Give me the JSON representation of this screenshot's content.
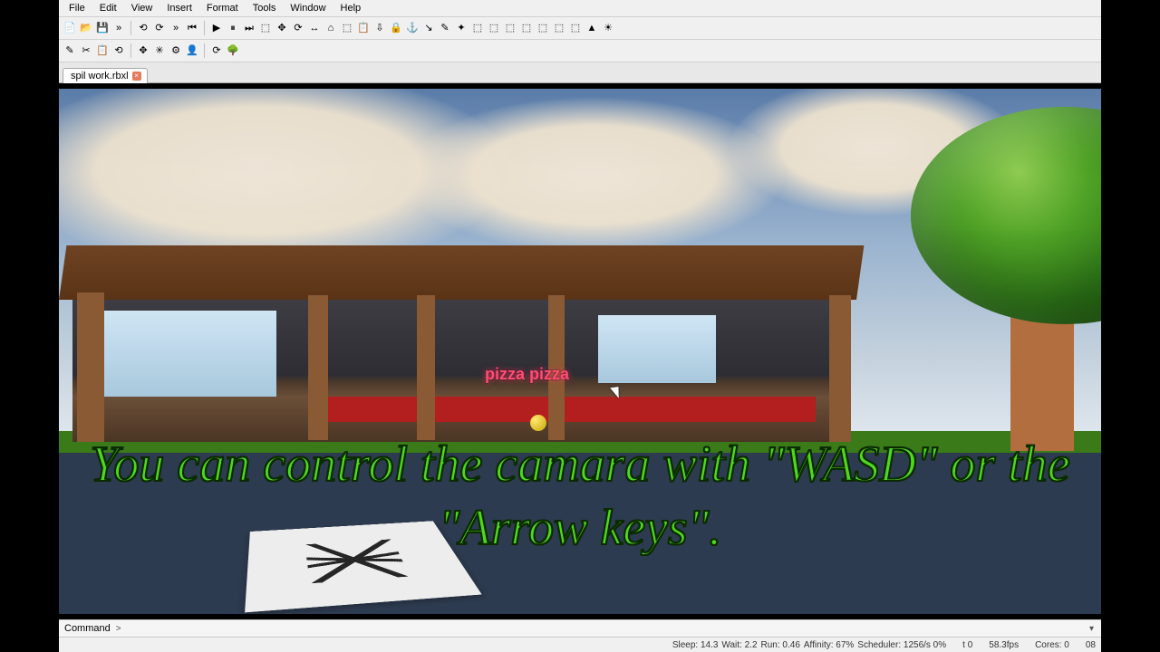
{
  "menu": {
    "file": "File",
    "edit": "Edit",
    "view": "View",
    "insert": "Insert",
    "format": "Format",
    "tools": "Tools",
    "window": "Window",
    "help": "Help"
  },
  "tab": {
    "name": "spil work.rbxl"
  },
  "scene": {
    "sign": "pizza pizza"
  },
  "caption": {
    "text": "You can control the camara with \"WASD\" or the \"Arrow keys\"."
  },
  "cmd": {
    "label": "Command",
    "value": ""
  },
  "status": {
    "sleep": "Sleep: 14.3",
    "wait": "Wait: 2.2",
    "run": "Run: 0.46",
    "affinity": "Affinity: 67%",
    "scheduler": "Scheduler: 1256/s 0%",
    "t": "t 0",
    "fps": "58.3fps",
    "cores": "Cores: 0",
    "extra": "08"
  },
  "toolbar_icons_row1": [
    "📄",
    "📂",
    "💾",
    "»",
    "⟲",
    "⟳",
    "»",
    "⏮",
    "▶",
    "⏸",
    "⏭",
    "⬚",
    "✥",
    "⟳",
    "↔",
    "⌂",
    "⬚",
    "📋",
    "⇩",
    "🔒",
    "⚓",
    "↘",
    "✎",
    "✦",
    "⬚",
    "⬚",
    "⬚",
    "⬚",
    "⬚",
    "⬚",
    "⬚",
    "▲",
    "☀"
  ],
  "toolbar_icons_row2": [
    "✎",
    "✂",
    "📋",
    "⟲",
    "✥",
    "✳",
    "⚙",
    "👤",
    "⟳",
    "🌳"
  ],
  "colors": {
    "accent_green": "#4fd81e"
  }
}
